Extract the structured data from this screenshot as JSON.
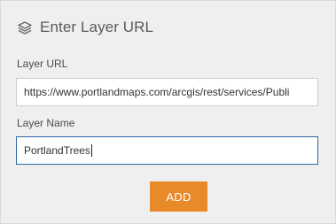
{
  "panel": {
    "title": "Enter Layer URL",
    "icon": "layers-icon"
  },
  "fields": {
    "url": {
      "label": "Layer URL",
      "value": "https://www.portlandmaps.com/arcgis/rest/services/Publi"
    },
    "name": {
      "label": "Layer Name",
      "value": "PortlandTrees"
    }
  },
  "actions": {
    "add_label": "ADD"
  },
  "colors": {
    "accent": "#e8892a",
    "focus_border": "#2b68a8",
    "panel_bg": "#efefef"
  }
}
